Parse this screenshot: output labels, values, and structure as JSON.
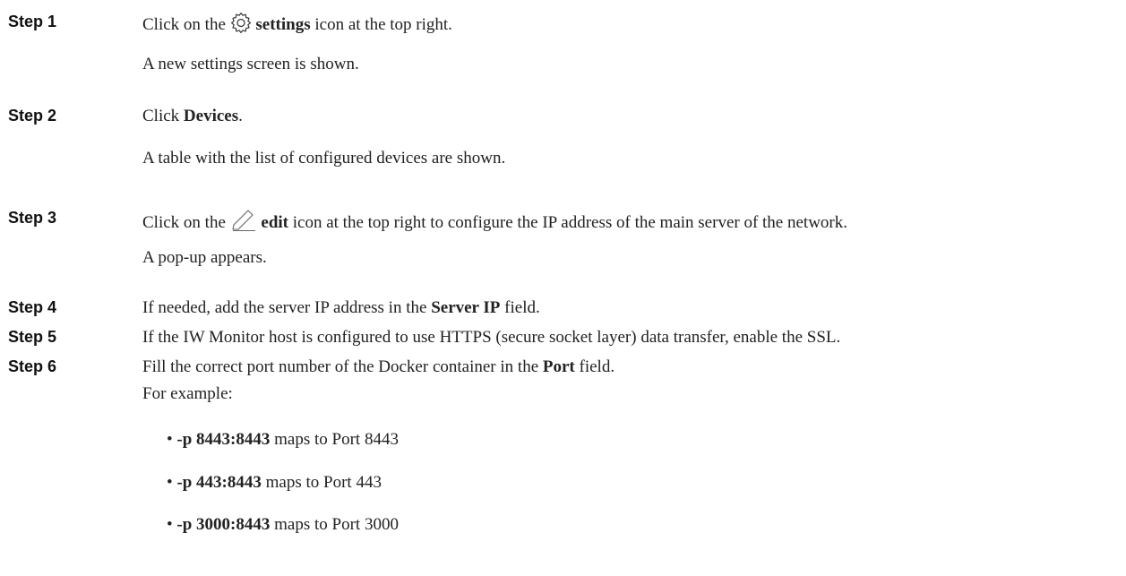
{
  "steps": [
    {
      "label": "Step 1",
      "pre": "Click on the",
      "icon": "gear-icon",
      "bold": "settings",
      "post": "icon at the top right.",
      "result": "A new settings screen is shown."
    },
    {
      "label": "Step 2",
      "pre": "Click",
      "bold": "Devices",
      "post": ".",
      "result": "A table with the list of configured devices are shown."
    },
    {
      "label": "Step 3",
      "pre": "Click on the",
      "icon": "pencil-icon",
      "bold": "edit",
      "post": "icon at the top right to configure the IP address of the main server of the network.",
      "result": "A pop-up appears."
    },
    {
      "label": "Step 4",
      "pre": "If needed, add the server IP address in the",
      "bold": "Server IP",
      "post": "field."
    },
    {
      "label": "Step 5",
      "text": "If the IW Monitor host is configured to use HTTPS (secure socket layer) data transfer, enable the SSL."
    },
    {
      "label": "Step 6",
      "pre": "Fill the correct port number of the Docker container in the",
      "bold": "Port",
      "post": "field.",
      "result": "For example:",
      "bullets": [
        {
          "bold": "-p 8443:8443",
          "text": "maps to Port 8443"
        },
        {
          "bold": "-p 443:8443",
          "text": "maps to Port 443"
        },
        {
          "bold": "-p 3000:8443",
          "text": "maps to Port 3000"
        }
      ]
    }
  ]
}
